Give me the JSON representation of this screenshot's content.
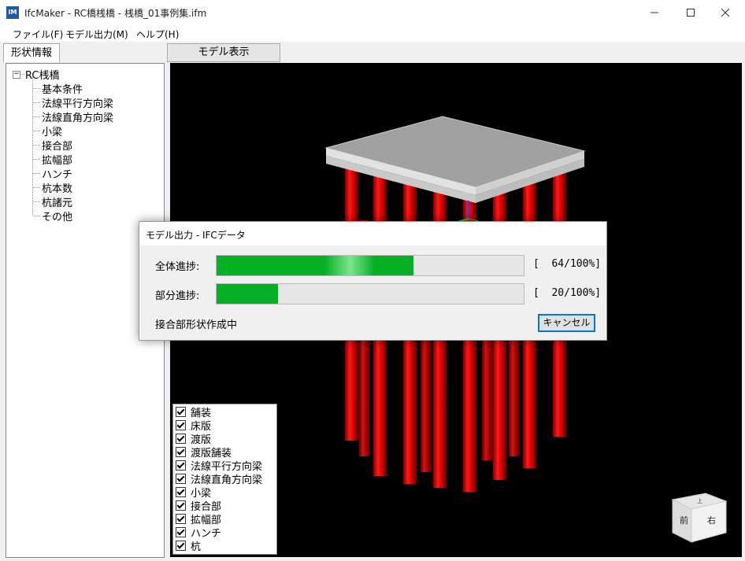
{
  "window": {
    "title": "IfcMaker - RC橋桟橋 - 桟橋_01事例集.ifm",
    "app_icon": "ifcmaker-app-icon"
  },
  "menu": [
    "ファイル(F)",
    "モデル出力(M)",
    "ヘルプ(H)"
  ],
  "left_tab": "形状情報",
  "right_tab": "モデル表示",
  "tree": {
    "root": "RC桟橋",
    "items": [
      "基本条件",
      "法線平行方向梁",
      "法線直角方向梁",
      "小梁",
      "接合部",
      "拡幅部",
      "ハンチ",
      "杭本数",
      "杭諸元",
      "その他"
    ]
  },
  "layers": [
    "舗装",
    "床版",
    "渡版",
    "渡版舗装",
    "法線平行方向梁",
    "法線直角方向梁",
    "小梁",
    "接合部",
    "拡幅部",
    "ハンチ",
    "杭"
  ],
  "dialog": {
    "title": "モデル出力 - IFCデータ",
    "overall_label": "全体進捗:",
    "overall_progress": 0.64,
    "overall_pct_text": "[  64/100%]",
    "partial_label": "部分進捗:",
    "partial_progress": 0.2,
    "partial_pct_text": "[  20/100%]",
    "status": "接合部形状作成中",
    "cancel_label": "キャンセル"
  },
  "view_cube": {
    "top": "上",
    "front": "前",
    "right": "右"
  },
  "colors": {
    "pile": "#e00000",
    "deck": "#a8a8a8",
    "progress": "#06b025",
    "viewport_bg": "#000000"
  }
}
